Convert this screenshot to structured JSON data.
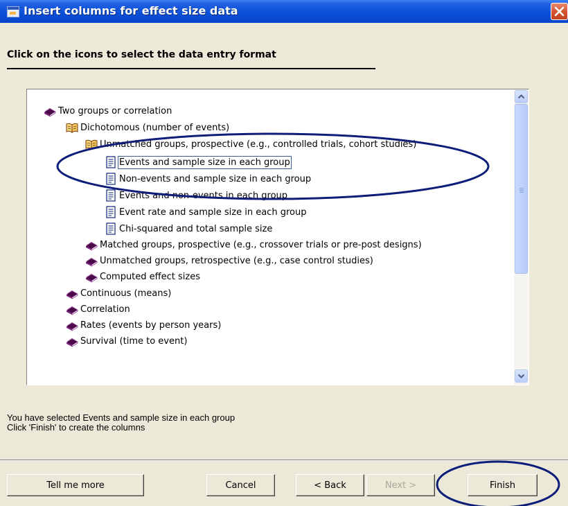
{
  "window": {
    "title": "Insert columns for effect size data"
  },
  "heading": "Click on the icons to select the data entry format",
  "tree": [
    {
      "label": "Two groups or correlation",
      "icon": "closed-book-icon",
      "level": 0
    },
    {
      "label": "Dichotomous (number of events)",
      "icon": "open-book-icon",
      "level": 1
    },
    {
      "label": "Unmatched groups, prospective (e.g., controlled trials, cohort studies)",
      "icon": "open-book-icon",
      "level": 2
    },
    {
      "label": "Events and sample size in each group",
      "icon": "page-icon",
      "level": 3,
      "selected": true
    },
    {
      "label": "Non-events and sample size in each group",
      "icon": "page-icon",
      "level": 3
    },
    {
      "label": "Events and non-events in each group",
      "icon": "page-icon",
      "level": 3
    },
    {
      "label": "Event rate and sample size in each group",
      "icon": "page-icon",
      "level": 3
    },
    {
      "label": "Chi-squared and total sample size",
      "icon": "page-icon",
      "level": 3
    },
    {
      "label": "Matched groups, prospective (e.g., crossover trials or pre-post designs)",
      "icon": "closed-book-icon",
      "level": 2
    },
    {
      "label": "Unmatched groups, retrospective (e.g., case control studies)",
      "icon": "closed-book-icon",
      "level": 2
    },
    {
      "label": "Computed effect sizes",
      "icon": "closed-book-icon",
      "level": 2
    },
    {
      "label": "Continuous (means)",
      "icon": "closed-book-icon",
      "level": 1
    },
    {
      "label": "Correlation",
      "icon": "closed-book-icon",
      "level": 1
    },
    {
      "label": "Rates (events by person years)",
      "icon": "closed-book-icon",
      "level": 1
    },
    {
      "label": "Survival (time to event)",
      "icon": "closed-book-icon",
      "level": 1
    }
  ],
  "status": {
    "line1": "You have selected Events and sample size in each group",
    "line2": "Click 'Finish' to create the columns"
  },
  "buttons": {
    "tell_me_more": "Tell me more",
    "cancel": "Cancel",
    "back": "< Back",
    "next": "Next >",
    "finish": "Finish"
  },
  "colors": {
    "titlebar": "#0a4fd8",
    "annotation_ellipse": "#0d1e7a",
    "dialog_face": "#ece9d8"
  }
}
